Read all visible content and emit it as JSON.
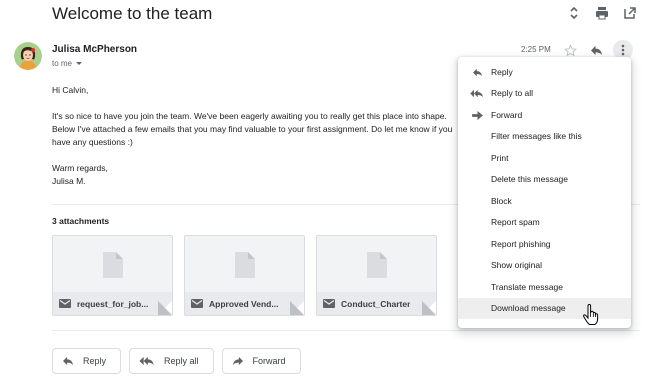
{
  "email": {
    "subject": "Welcome to the team",
    "sender": "Julisa McPherson",
    "recipient": "to me",
    "time": "2:25 PM",
    "body": {
      "greeting": "Hi Calvin,",
      "paragraph": "It's so nice to have you join the team. We've been eagerly awaiting you to really get this place into shape. Below I've attached a few emails that you may find valuable to your first assignment. Do let me know if you have any questions :)",
      "signoff_line1": "Warm regards,",
      "signoff_line2": "Julisa M."
    }
  },
  "top_actions": [
    "expand-collapse-icon",
    "print-icon",
    "open-in-new-window-icon"
  ],
  "attachments": {
    "title": "3 attachments",
    "items": [
      {
        "name": "request_for_job..."
      },
      {
        "name": "Approved Vend..."
      },
      {
        "name": "Conduct_Charter"
      }
    ]
  },
  "reply_buttons": {
    "reply": "Reply",
    "reply_all": "Reply all",
    "forward": "Forward"
  },
  "menu": {
    "items": [
      {
        "label": "Reply",
        "icon": "reply-icon"
      },
      {
        "label": "Reply to all",
        "icon": "reply-all-icon"
      },
      {
        "label": "Forward",
        "icon": "forward-icon"
      },
      {
        "label": "Filter messages like this",
        "icon": ""
      },
      {
        "label": "Print",
        "icon": ""
      },
      {
        "label": "Delete this message",
        "icon": ""
      },
      {
        "label": "Block",
        "icon": ""
      },
      {
        "label": "Report spam",
        "icon": ""
      },
      {
        "label": "Report phishing",
        "icon": ""
      },
      {
        "label": "Show original",
        "icon": ""
      },
      {
        "label": "Translate message",
        "icon": ""
      },
      {
        "label": "Download message",
        "icon": ""
      }
    ],
    "hovered": "Download message"
  },
  "colors": {
    "text": "#202124",
    "secondary": "#5f6368",
    "border": "#dadce0",
    "menu_hover": "#eeeeee"
  }
}
